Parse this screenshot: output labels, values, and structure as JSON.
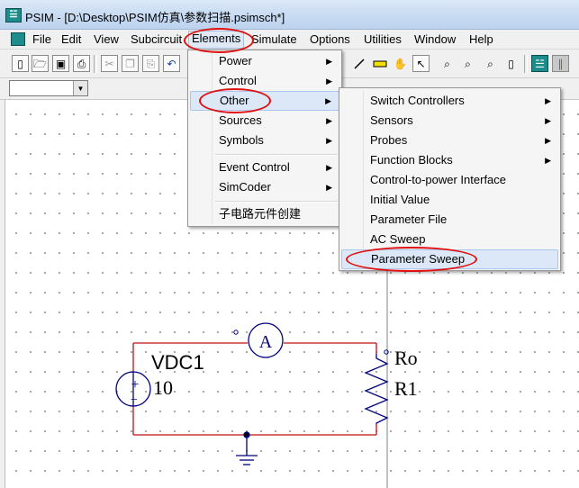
{
  "window": {
    "title": "PSIM - [D:\\Desktop\\PSIM仿真\\参数扫描.psimsch*]"
  },
  "menubar": {
    "items": [
      {
        "label": "File"
      },
      {
        "label": "Edit"
      },
      {
        "label": "View"
      },
      {
        "label": "Subcircuit"
      },
      {
        "label": "Elements"
      },
      {
        "label": "Simulate"
      },
      {
        "label": "Options"
      },
      {
        "label": "Utilities"
      },
      {
        "label": "Window"
      },
      {
        "label": "Help"
      }
    ]
  },
  "toolbar": {
    "icons": [
      "new-file-icon",
      "open-folder-icon",
      "save-icon",
      "print-icon",
      "cut-icon",
      "copy-icon",
      "paste-icon",
      "undo-icon",
      "wire-icon",
      "label-icon",
      "hand-icon",
      "select-arrow-icon",
      "zoom-in-icon",
      "zoom-out-icon",
      "zoom-fit-icon",
      "page-icon",
      "run-simulation-icon",
      "pause-icon"
    ],
    "combo_value": ""
  },
  "elements_menu": {
    "items": [
      {
        "label": "Power",
        "submenu": true
      },
      {
        "label": "Control",
        "submenu": true
      },
      {
        "label": "Other",
        "submenu": true
      },
      {
        "label": "Sources",
        "submenu": true
      },
      {
        "label": "Symbols",
        "submenu": true
      },
      {
        "label": "Event Control",
        "submenu": true
      },
      {
        "label": "SimCoder",
        "submenu": true
      },
      {
        "label": "子电路元件创建",
        "submenu": false
      }
    ]
  },
  "other_menu": {
    "items": [
      {
        "label": "Switch Controllers",
        "submenu": true
      },
      {
        "label": "Sensors",
        "submenu": true
      },
      {
        "label": "Probes",
        "submenu": true
      },
      {
        "label": "Function Blocks",
        "submenu": true
      },
      {
        "label": "Control-to-power Interface",
        "submenu": false
      },
      {
        "label": "Initial Value",
        "submenu": false
      },
      {
        "label": "Parameter File",
        "submenu": false
      },
      {
        "label": "AC Sweep",
        "submenu": false
      },
      {
        "label": "Parameter Sweep",
        "submenu": false
      }
    ]
  },
  "schematic": {
    "source_name": "VDC1",
    "source_value": "10",
    "ammeter_symbol": "A",
    "resistor_param": "Ro",
    "resistor_name": "R1",
    "source_plus": "+",
    "source_minus": "−"
  },
  "colors": {
    "wire": "#c01010",
    "highlight": "#e01010",
    "component": "#000080",
    "menu_hover": "#dce8f7"
  }
}
